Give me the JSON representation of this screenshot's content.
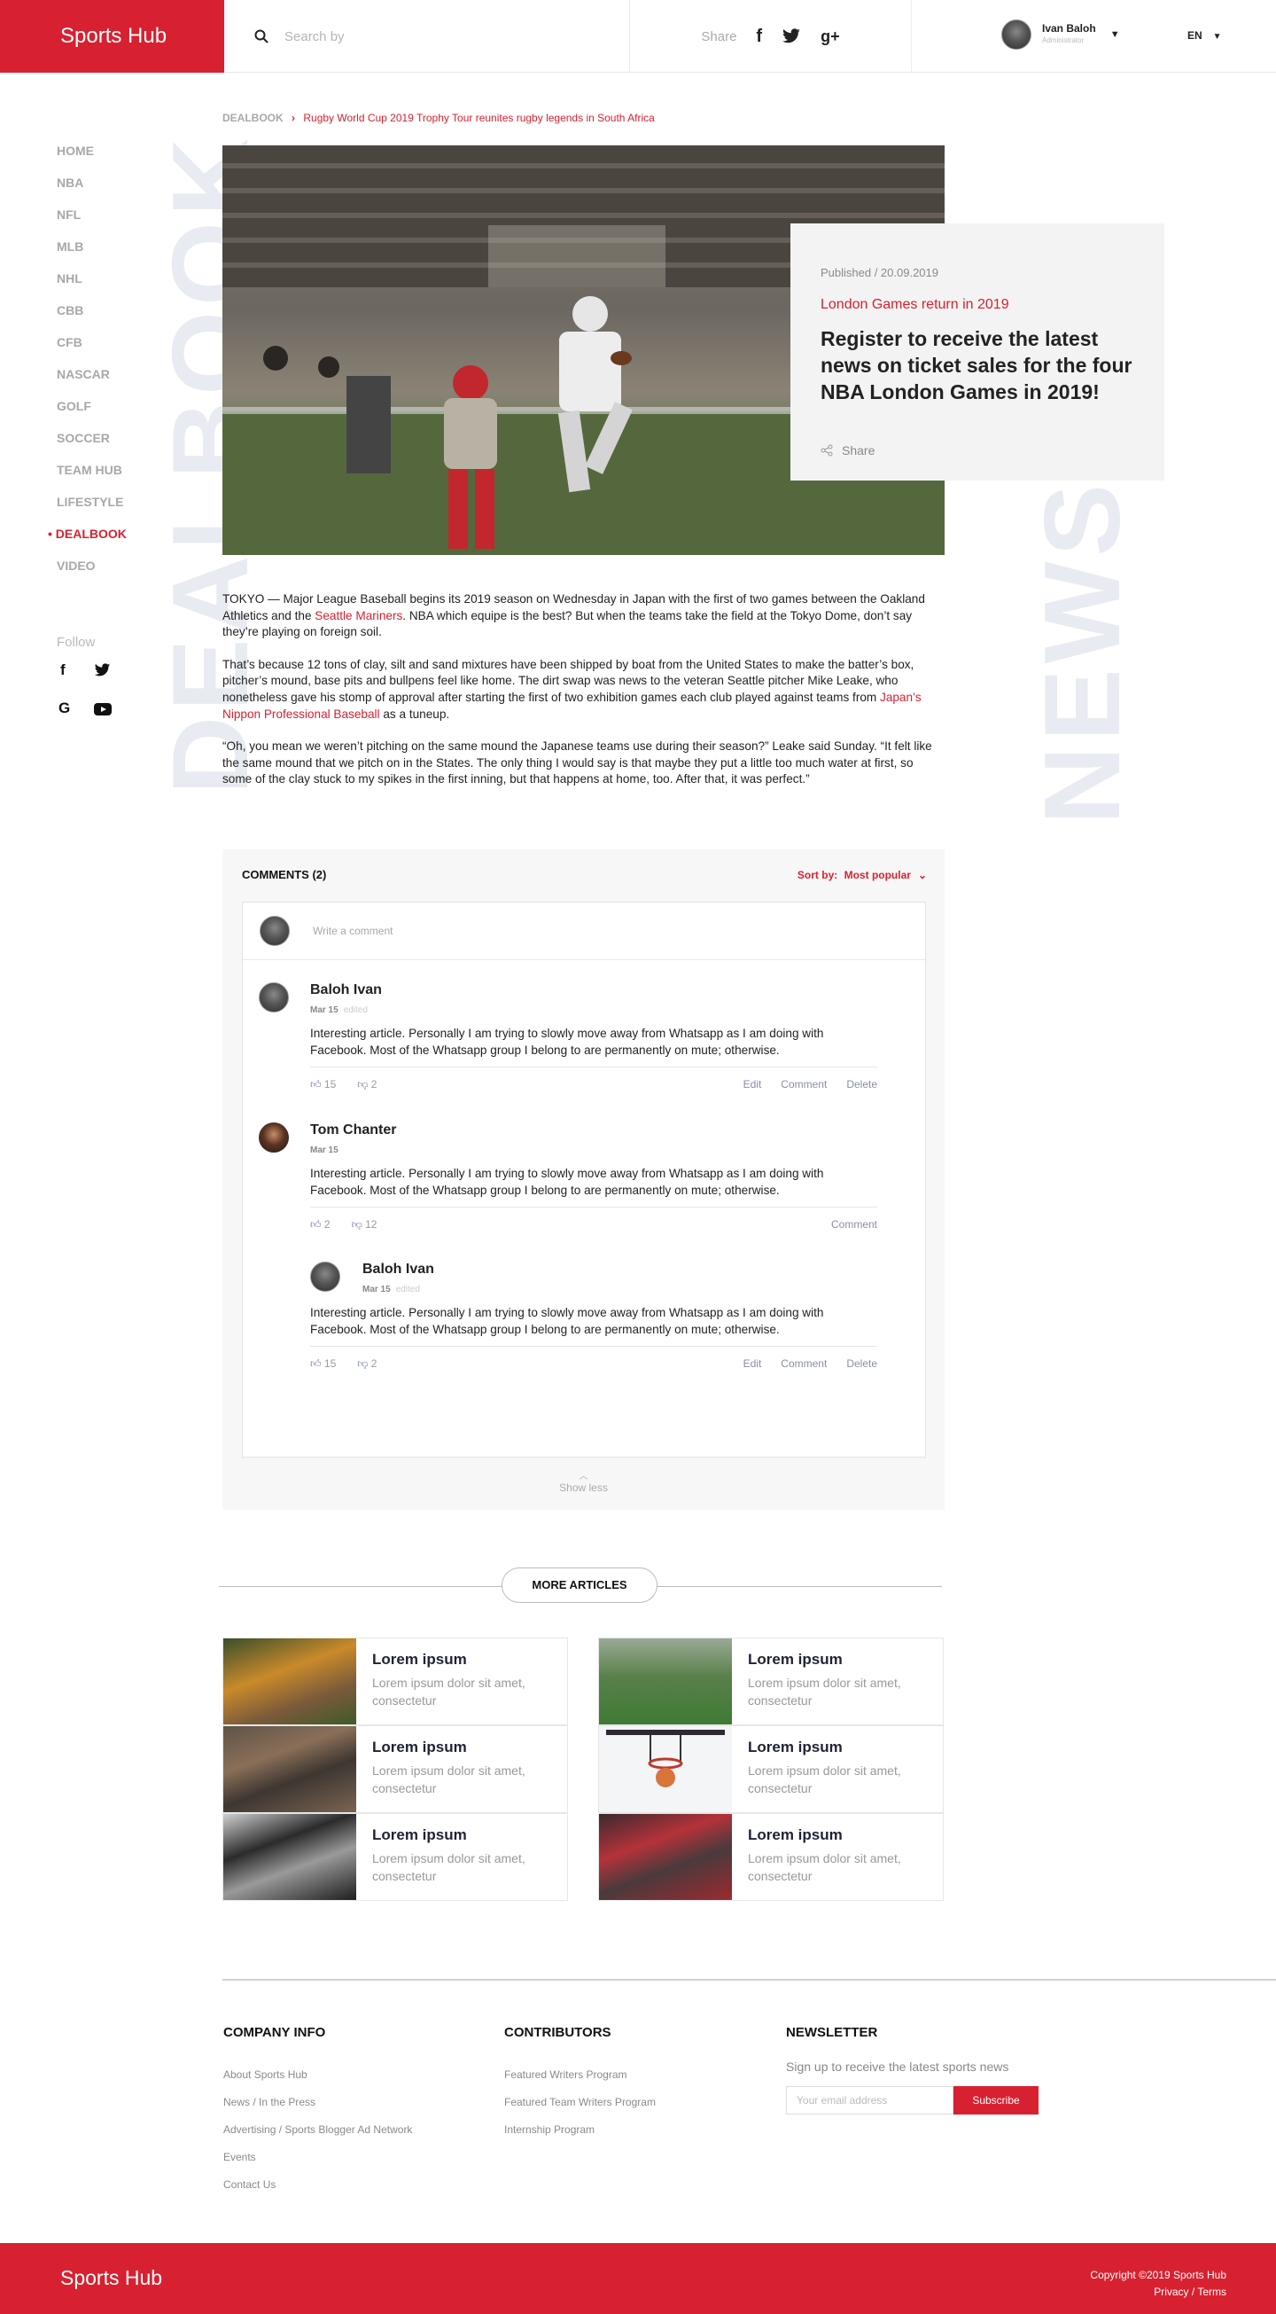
{
  "header": {
    "logo": "Sports Hub",
    "search_placeholder": "Search by",
    "share_label": "Share",
    "user_name": "Ivan Baloh",
    "user_role": "Administrator",
    "language": "EN"
  },
  "sidebar": {
    "items": [
      {
        "label": "HOME"
      },
      {
        "label": "NBA"
      },
      {
        "label": "NFL"
      },
      {
        "label": "MLB"
      },
      {
        "label": "NHL"
      },
      {
        "label": "CBB"
      },
      {
        "label": "CFB"
      },
      {
        "label": "NASCAR"
      },
      {
        "label": "GOLF"
      },
      {
        "label": "SOCCER"
      },
      {
        "label": "TEAM HUB"
      },
      {
        "label": "LIFESTYLE"
      },
      {
        "label": "DEALBOOK"
      },
      {
        "label": "VIDEO"
      }
    ],
    "active": "DEALBOOK",
    "follow_label": "Follow"
  },
  "watermark": {
    "left": "DEALBOOK",
    "right": "NEWS"
  },
  "breadcrumb": {
    "parent": "DEALBOOK",
    "current": "Rugby World Cup 2019 Trophy Tour reunites rugby legends in South Africa"
  },
  "card": {
    "published": "Published / 20.09.2019",
    "category": "London Games return in 2019",
    "headline": "Register to receive the latest news on ticket sales for the four NBA London Games in 2019!",
    "share": "Share"
  },
  "article": {
    "p1a": "TOKYO — Major League Baseball begins its 2019 season on Wednesday in Japan with the first of two games between the Oakland Athletics and the ",
    "p1_link": "Seattle Mariners",
    "p1b": ". NBA which equipe is the best? But when the teams take the field at the Tokyo Dome, don’t say they’re playing on foreign soil.",
    "p2a": "That’s because 12 tons of clay, silt and sand mixtures have been shipped by boat from the United States to make the batter’s box, pitcher’s mound, base pits and bullpens feel like home. The dirt swap was news to the veteran Seattle pitcher Mike Leake, who nonetheless gave his stomp of approval after starting the first of two exhibition games each club played against teams from ",
    "p2_link": "Japan’s Nippon Professional Baseball",
    "p2b": " as a tuneup.",
    "p3": "“Oh, you mean we weren’t pitching on the same mound the Japanese teams use during their season?” Leake said Sunday. “It felt like the same mound that we pitch on in the States. The only thing I would say is that maybe they put a little too much water at first, so some of the clay stuck to my spikes in the first inning, but that happens at home, too. After that, it was perfect.”"
  },
  "comments": {
    "title": "COMMENTS (2)",
    "sort_label": "Sort by:",
    "sort_value": "Most popular",
    "write_placeholder": "Write a comment",
    "show_less": "Show less",
    "items": [
      {
        "author": "Baloh Ivan",
        "date": "Mar 15",
        "edited": "edited",
        "text": "Interesting article. Personally I am trying to slowly move away from Whatsapp as I am doing with Facebook. Most of the Whatsapp group I belong to are permanently on mute; otherwise.",
        "likes": "15",
        "dislikes": "2",
        "actions": [
          "Edit",
          "Comment",
          "Delete"
        ]
      },
      {
        "author": "Tom Chanter",
        "date": "Mar 15",
        "edited": "",
        "text": "Interesting article. Personally I am trying to slowly move away from Whatsapp as I am doing with Facebook. Most of the Whatsapp group I belong to are permanently on mute; otherwise.",
        "likes": "2",
        "dislikes": "12",
        "actions": [
          "Comment"
        ]
      },
      {
        "author": "Baloh Ivan",
        "date": "Mar 15",
        "edited": "edited",
        "text": "Interesting article. Personally I am trying to slowly move away from Whatsapp as I am doing with Facebook. Most of the Whatsapp group I belong to are permanently on mute; otherwise.",
        "likes": "15",
        "dislikes": "2",
        "actions": [
          "Edit",
          "Comment",
          "Delete"
        ]
      }
    ]
  },
  "more_articles": {
    "label": "MORE ARTICLES",
    "items": [
      {
        "title": "Lorem ipsum",
        "desc": "Lorem ipsum dolor sit amet, consectetur"
      },
      {
        "title": "Lorem ipsum",
        "desc": "Lorem ipsum dolor sit amet, consectetur"
      },
      {
        "title": "Lorem ipsum",
        "desc": "Lorem ipsum dolor sit amet, consectetur"
      },
      {
        "title": "Lorem ipsum",
        "desc": "Lorem ipsum dolor sit amet, consectetur"
      },
      {
        "title": "Lorem ipsum",
        "desc": "Lorem ipsum dolor sit amet, consectetur"
      },
      {
        "title": "Lorem ipsum",
        "desc": "Lorem ipsum dolor sit amet, consectetur"
      }
    ]
  },
  "footer": {
    "company_title": "COMPANY INFO",
    "company_links": [
      "About Sports Hub",
      "News / In the Press",
      "Advertising / Sports Blogger Ad Network",
      "Events",
      "Contact Us"
    ],
    "contrib_title": "CONTRIBUTORS",
    "contrib_links": [
      "Featured Writers Program",
      "Featured Team Writers Program",
      "Internship Program"
    ],
    "news_title": "NEWSLETTER",
    "news_text": "Sign up to receive the latest sports news",
    "email_placeholder": "Your email address",
    "subscribe": "Subscribe",
    "logo": "Sports Hub",
    "copyright": "Copyright ©2019 Sports Hub",
    "privacy": "Privacy / Terms"
  },
  "colors": {
    "brand": "#d72130"
  }
}
